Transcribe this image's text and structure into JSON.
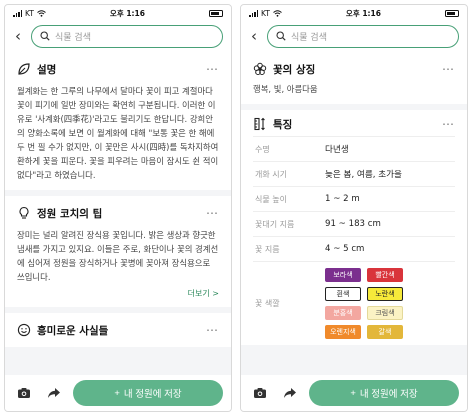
{
  "status": {
    "carrier": "KT",
    "time": "오후 1:16"
  },
  "search": {
    "placeholder": "식물 검색"
  },
  "left": {
    "description": {
      "title": "설명",
      "text": "월계화는 한 그루의 나무에서 달마다 꽃이 피고 계절마다 꽃이 피기에 일반 장미와는 확연히 구분됩니다. 이러한 이유로 '사계화(四季花)'라고도 불리기도 한답니다. 강희안의 양화소록에 보면 이 월계화에 대해 \"보통 꽃은 한 해에 두 번 필 수가 없지만, 이 꽃만은 사시(四時)를 독차지하여 환하게 꽃을 피운다. 꽃을 피우려는 마음이 잠시도 쉰 적이 없다\"라고 하였습니다."
    },
    "tips": {
      "title": "정원 코치의 팁",
      "text": "장미는 널리 알려진 장식용 꽃입니다. 밝은 생상과 향긋한 냄새를 가지고 있지요. 이들은 주로, 화단이나 꽃의 경계선에 심어져 정원을 장식하거나 꽃병에 꽂아져 장식용으로 쓰입니다.",
      "more_label": "더보기 >"
    },
    "facts": {
      "title": "흥미로운 사실들"
    }
  },
  "right": {
    "symbol": {
      "title": "꽃의 상징",
      "text": "행복, 빛, 아름다움"
    },
    "traits": {
      "title": "특징",
      "rows": [
        {
          "key": "수명",
          "value": "다년생"
        },
        {
          "key": "개화 시기",
          "value": "늦은 봄, 여름, 초가을"
        },
        {
          "key": "식물 높이",
          "value": "1 ~ 2 m"
        },
        {
          "key": "꽃대기 지름",
          "value": "91 ~ 183 cm"
        },
        {
          "key": "꽃 지름",
          "value": "4 ~ 5 cm"
        }
      ],
      "color_key": "꽃 색깔",
      "colors": [
        {
          "label": "보라색",
          "bg": "#7b2f8e",
          "fg": "#ffffff",
          "border": "#7b2f8e"
        },
        {
          "label": "빨간색",
          "bg": "#d9343b",
          "fg": "#ffffff",
          "border": "#d9343b"
        },
        {
          "label": "흰색",
          "bg": "#ffffff",
          "fg": "#222222",
          "border": "#222222"
        },
        {
          "label": "노란색",
          "bg": "#f6ea3a",
          "fg": "#222222",
          "border": "#222222"
        },
        {
          "label": "분홍색",
          "bg": "#f3a7a0",
          "fg": "#ffffff",
          "border": "#f3a7a0"
        },
        {
          "label": "크림색",
          "bg": "#fbf3c4",
          "fg": "#555555",
          "border": "#e4d99a"
        },
        {
          "label": "오렌지색",
          "bg": "#f08a2b",
          "fg": "#ffffff",
          "border": "#f08a2b"
        },
        {
          "label": "갈색",
          "bg": "#e3b73a",
          "fg": "#ffffff",
          "border": "#e3b73a"
        }
      ]
    }
  },
  "bottom": {
    "save_label": "내 정원에 저장"
  },
  "accent": "#5fb48b"
}
